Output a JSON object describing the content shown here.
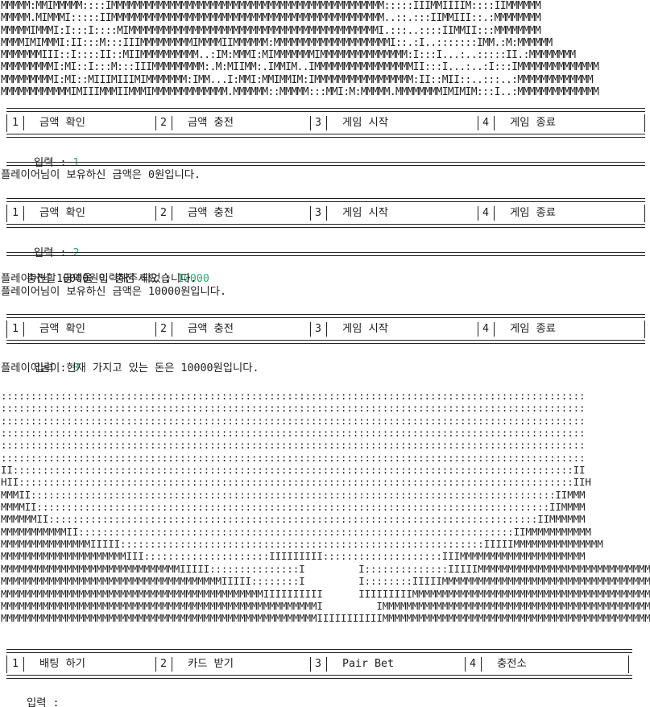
{
  "title_art": [
    "MMMMM:MMIMMMMM::::IMMMMMMMMMMMMMMMMMMMMMMMMMMMMMMMMMMMMMMMMMMMMMMM:::::IIIMMIIIIM::::IIMMMMMM",
    "MMMMM.MIMMMI:::::IIMMMMMMMMMMMMMMMMMMMMMMMMMMMMMMMMMMMMMMMMMMMMMMM..::.:::IIMMIII::.:MMMMMMMM",
    "MMMMMIMMMI:I:::I::::MIMMMMMMMMMMMMMMMMMMMMMMMMMMMMMMMMMMMMMMMMMMMI.:::..::::IIMMII:::MMMMMMMM",
    "MMMMIMIMMMI:II:::M:::IIIMMMMMMMMMIMMMMIIMMMMMM:MMMMMMMMMMMMMMMMMMMMI::.:I..:::::::IMM.:M:MMMMMM",
    "MMMMMMMIII::I::::II::MIIMMMMMMMMMM..:IM:MMMI:MIMMMMMMMIMMMMMMMMMMMMMMM:I:::I...:..:::::II.:MMMMMMMM",
    "MMMMMMMMMI:MI::I:::M:::IIIMMMMMMMMM:.M:MIIMM:.IMMIM..IMMMMMMMMMMMMMMMMMII:::I...:..:I:::IMMMMMMMMMMMMMM",
    "MMMMMMMMMI:MI::MIIIMIIIMIMMMMMMM:IMM...I:MMI:MMIMMIM:IMMMMMMMMMMMMMMMMM:II::MII::..:::..:MMMMMMMMMMMMM",
    "MMMMMMMMMMMMIMIIIMMMIIMMMIMMMMMMMMMMMMM.MMMMMM::MMMMM:::MMI:M:MMMMM.MMMMMMMMIMIMIM:::I..:MMMMMMMMMMMMMM"
  ],
  "main_menu": [
    {
      "num": "1",
      "label": "금액 확인"
    },
    {
      "num": "2",
      "label": "금액 충전"
    },
    {
      "num": "3",
      "label": "게임 시작"
    },
    {
      "num": "4",
      "label": "게임 종료"
    }
  ],
  "game_menu": [
    {
      "num": "1",
      "label": "배팅 하기"
    },
    {
      "num": "2",
      "label": "카드 받기"
    },
    {
      "num": "3",
      "label": "Pair Bet"
    },
    {
      "num": "4",
      "label": "충전소"
    }
  ],
  "input_prompt": "입력 : ",
  "session": {
    "input1": "1",
    "balance_msg": "플레이어님이 보유하신 금액은 0원입니다.",
    "input2": "2",
    "charge_prompt": "충전할 금액을 입력해주세요 : ",
    "charge_amount": "10000",
    "charged_msg": "플레이어님 10000원이 충전 되었습니다.",
    "balance_msg2": "플레이어님이 보유하신 금액은 10000원입니다.",
    "input3": "3",
    "current_money_msg": "플레이어님이 현재 가지고 있는 돈은 10000원입니다.",
    "final_prompt": "입력 : "
  },
  "table_art": [
    "::::::::::::::::::::::::::::::::::::::::::::::::::::::::::::::::::::::::::::::::::::::::::::::::::",
    "::::::::::::::::::::::::::::::::::::::::::::::::::::::::::::::::::::::::::::::::::::::::::::::::::",
    "::::::::::::::::::::::::::::::::::::::::::::::::::::::::::::::::::::::::::::::::::::::::::::::::::",
    "::::::::::::::::::::::::::::::::::::::::::::::::::::::::::::::::::::::::::::::::::::::::::::::::::",
    "::::::::::::::::::::::::::::::::::::::::::::::::::::::::::::::::::::::::::::::::::::::::::::::::::",
    "::::::::::::::::::::::::::::::::::::::::::::::::::::::::::::::::::::::::::::::::::::::::::::::::::",
    "II::::::::::::::::::::::::::::::::::::::::::::::::::::::::::::::::::::::::::::::::::::::::::::::II",
    "HII:::::::::::::::::::::::::::::::::::::::::::::::::::::::::::::::::::::::::::::::::::::::::::::IIH",
    "MMMII::::::::::::::::::::::::::::::::::::::::::::::::::::::::::::::::::::::::::::::::::::::::IIMMM",
    "MMMMII::::::::::::::::::::::::::::::::::::::::::::::::::::::::::::::::::::::::::::::::::::::IIMMMM",
    "MMMMMMII::::::::::::::::::::::::::::::::::::::::::::::::::::::::::::::::::::::::::::::::::IIMMMMMM",
    "MMMMMMMMMMMII:::::::::::::::::::::::::::::::::::::::::::::::::::::::::::::::::::::::::IIMMMMMMMMMMM",
    "MMMMMMMMMMMMMMMIIIII:::::::::::::::::::::::::::::::::::::::::::::::::::::::::::::IIIIIMMMMMMMMMMMMMMM",
    "MMMMMMMMMMMMMMMMMMMMMIII:::::::::::::::::::::IIIIIIIII::::::::::::::::::::IIIMMMMMMMMMMMMMMMMMMMMM",
    "MMMMMMMMMMMMMMMMMMMMMMMMMMMMMMIIIII:::::::::::::::I         I::::::::::::::IIIIIMMMMMMMMMMMMMMMMMMMMMMMMMMMMMM",
    "MMMMMMMMMMMMMMMMMMMMMMMMMMMMMMMMMMMMMIIIII::::::::I         I::::::::IIIIIMMMMMMMMMMMMMMMMMMMMMMMMMMMMMMMMMMMM",
    "MMMMMMMMMMMMMMMMMMMMMMMMMMMMMMMMMMMMMMMMMMMMIIIIIIIIII      IIIIIIIIIMMMMMMMMMMMMMMMMMMMMMMMMMMMMMMMMMMMMMMMMMM",
    "MMMMMMMMMMMMMMMMMMMMMMMMMMMMMMMMMMMMMMMMMMMMMMMMMMMMMI         IMMMMMMMMMMMMMMMMMMMMMMMMMMMMMMMMMMMMMMMMMMMMMM",
    "MMMMMMMMMMMMMMMMMMMMMMMMMMMMMMMMMMMMMMMMMMMMMMMMMMMMMIIIIIIIIIIIMMMMMMMMMMMMMMMMMMMMMMMMMMMMMMMMMMMMMMMMMMMMMMM"
  ]
}
